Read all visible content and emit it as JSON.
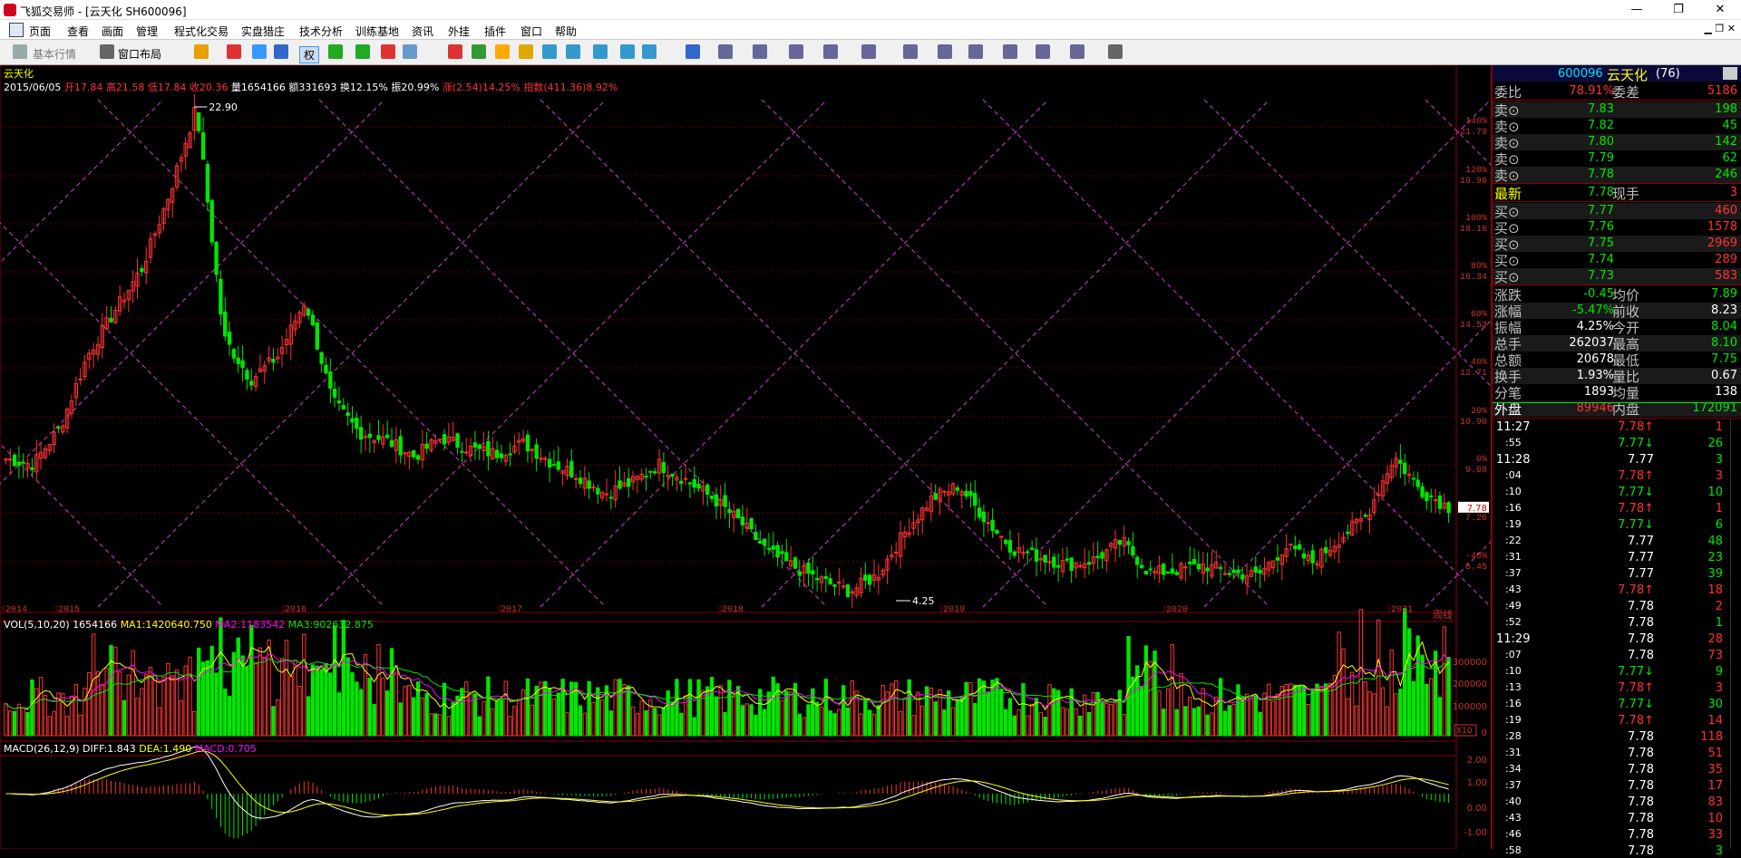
{
  "window": {
    "title": "飞狐交易师 - [云天化 SH600096]",
    "min": "—",
    "max": "❐",
    "close": "✕"
  },
  "menu": {
    "items": [
      "页面",
      "查看",
      "画面",
      "管理",
      "程式化交易",
      "实盘猎庄",
      "技术分析",
      "训练基地",
      "资讯",
      "外挂",
      "插件",
      "窗口",
      "帮助"
    ],
    "ctrl": "▁ ❐ ✕"
  },
  "toolbar": {
    "basic": "基本行情",
    "layout": "窗口布局",
    "quan": "权"
  },
  "colors": {
    "up": "#ff3232",
    "down": "#00e600",
    "neutral": "#ffffff",
    "accent": "#ffff00",
    "grid": "#8b0000",
    "gann": "#cc44cc",
    "ma2": "#ff00ff",
    "scale": "#cc3333"
  },
  "main_chart": {
    "name": "云天化",
    "info": {
      "date": "2015/06/05",
      "open": "开17.84",
      "high": "高21.58",
      "low": "低17.84",
      "close": "收20.36",
      "vol": "量1654166",
      "amt": "额331693",
      "turnover": "换12.15%",
      "amp": "振20.99%",
      "chg": "涨(2.54)14.25%",
      "idx": "指数(411.36)8.92%"
    },
    "high_mark": "22.90",
    "low_mark": "4.25",
    "period": "周线",
    "last_price_tag": "7.78",
    "years": [
      "2014",
      "2015",
      "2016",
      "2017",
      "2018",
      "2019",
      "2020",
      "2021"
    ],
    "pct_labels": [
      "140%",
      "120%",
      "100%",
      "80%",
      "60%",
      "40%",
      "20%",
      "0%",
      "-20%",
      "-40%"
    ],
    "price_labels": [
      "21.79",
      "19.96",
      "18.16",
      "16.34",
      "14.53",
      "12.71",
      "10.90",
      "9.08",
      "7.26",
      "5.45"
    ]
  },
  "vol_panel": {
    "title": "VOL(5,10,20)",
    "vol": "1654166",
    "ma1": "MA1:1420640.750",
    "ma2": "MA2:1183542",
    "ma3": "MA3:902632.875",
    "scale": [
      "300000",
      "200000",
      "100000",
      "0"
    ],
    "unit": "X10"
  },
  "macd_panel": {
    "title": "MACD(26,12,9)",
    "diff": "DIFF:1.843",
    "dea": "DEA:1.490",
    "macd": "MACD:0.705",
    "scale": [
      "2.00",
      "1.00",
      "0.00",
      "-1.00"
    ]
  },
  "chart_data": {
    "type": "candlestick",
    "title": "云天化",
    "xlabel": "",
    "ylabel": "",
    "period": "周线",
    "ylim": [
      4.25,
      22.9
    ],
    "x": [
      "2014",
      "2015",
      "2016",
      "2017",
      "2018",
      "2019",
      "2020",
      "2021"
    ],
    "series": [
      {
        "values": [
          9.6,
          9.4,
          10.8,
          13.5,
          15.2,
          16.8,
          19.6,
          22.9,
          14.2,
          12.6,
          13.5,
          15.6,
          11.8,
          10.6,
          10.3,
          9.7,
          10.4,
          10.0,
          9.8,
          10.2,
          9.5,
          9.0,
          8.3,
          8.7,
          9.4,
          8.8,
          8.1,
          7.2,
          6.1,
          5.5,
          5.0,
          4.6,
          5.2,
          6.8,
          8.1,
          8.6,
          7.3,
          6.2,
          5.9,
          5.6,
          5.8,
          6.5,
          5.3,
          5.4,
          5.6,
          5.3,
          5.2,
          6.3,
          5.7,
          6.6,
          7.5,
          9.7,
          8.4,
          7.78
        ]
      }
    ]
  },
  "quote": {
    "code": "600096",
    "name": "云天化",
    "num": "(76)",
    "weibi_label": "委比",
    "weibi": "78.91%",
    "weicha_label": "委差",
    "weicha": "5186",
    "sell": [
      {
        "label": "卖⊙",
        "price": "7.83",
        "vol": "198"
      },
      {
        "label": "卖⊙",
        "price": "7.82",
        "vol": "45"
      },
      {
        "label": "卖⊙",
        "price": "7.80",
        "vol": "142"
      },
      {
        "label": "卖⊙",
        "price": "7.79",
        "vol": "62"
      },
      {
        "label": "卖⊙",
        "price": "7.78",
        "vol": "246"
      }
    ],
    "latest_label": "最新",
    "latest": "7.78",
    "xianshou_label": "现手",
    "xianshou": "3",
    "buy": [
      {
        "label": "买⊙",
        "price": "7.77",
        "vol": "460"
      },
      {
        "label": "买⊙",
        "price": "7.76",
        "vol": "1578"
      },
      {
        "label": "买⊙",
        "price": "7.75",
        "vol": "2969"
      },
      {
        "label": "买⊙",
        "price": "7.74",
        "vol": "289"
      },
      {
        "label": "买⊙",
        "price": "7.73",
        "vol": "583"
      }
    ],
    "stats": [
      {
        "l1": "涨跌",
        "v1": "-0.45",
        "l2": "均价",
        "v2": "7.89"
      },
      {
        "l1": "涨幅",
        "v1": "-5.47%",
        "l2": "前收",
        "v2": "8.23"
      },
      {
        "l1": "振幅",
        "v1": "4.25%",
        "l2": "今开",
        "v2": "8.04"
      },
      {
        "l1": "总手",
        "v1": "262037",
        "l2": "最高",
        "v2": "8.10"
      },
      {
        "l1": "总额",
        "v1": "20678",
        "l2": "最低",
        "v2": "7.75"
      },
      {
        "l1": "换手",
        "v1": "1.93%",
        "l2": "量比",
        "v2": "0.67"
      },
      {
        "l1": "分笔",
        "v1": "1893",
        "l2": "均量",
        "v2": "138"
      },
      {
        "l1": "外盘",
        "v1": "89946",
        "l2": "内盘",
        "v2": "172091"
      }
    ],
    "ticks": [
      {
        "t": "11:27",
        "p": "7.78",
        "a": "↑",
        "v": "1",
        "s": "S"
      },
      {
        "t": ":55",
        "p": "7.77",
        "a": "↓",
        "v": "26",
        "s": "B"
      },
      {
        "t": "11:28",
        "p": "7.77",
        "a": "",
        "v": "3",
        "s": "B"
      },
      {
        "t": ":04",
        "p": "7.78",
        "a": "↑",
        "v": "3",
        "s": "S"
      },
      {
        "t": ":10",
        "p": "7.77",
        "a": "↓",
        "v": "10",
        "s": "B"
      },
      {
        "t": ":16",
        "p": "7.78",
        "a": "↑",
        "v": "1",
        "s": "S"
      },
      {
        "t": ":19",
        "p": "7.77",
        "a": "↓",
        "v": "6",
        "s": "B"
      },
      {
        "t": ":22",
        "p": "7.77",
        "a": "",
        "v": "48",
        "s": "B"
      },
      {
        "t": ":31",
        "p": "7.77",
        "a": "",
        "v": "23",
        "s": "B"
      },
      {
        "t": ":37",
        "p": "7.77",
        "a": "",
        "v": "39",
        "s": "B"
      },
      {
        "t": ":43",
        "p": "7.78",
        "a": "↑",
        "v": "18",
        "s": "S"
      },
      {
        "t": ":49",
        "p": "7.78",
        "a": "",
        "v": "2",
        "s": "S"
      },
      {
        "t": ":52",
        "p": "7.78",
        "a": "",
        "v": "1",
        "s": "B"
      },
      {
        "t": "11:29",
        "p": "7.78",
        "a": "",
        "v": "28",
        "s": "S"
      },
      {
        "t": ":07",
        "p": "7.78",
        "a": "",
        "v": "73",
        "s": "S"
      },
      {
        "t": ":10",
        "p": "7.77",
        "a": "↓",
        "v": "9",
        "s": "B"
      },
      {
        "t": ":13",
        "p": "7.78",
        "a": "↑",
        "v": "3",
        "s": "S"
      },
      {
        "t": ":16",
        "p": "7.77",
        "a": "↓",
        "v": "30",
        "s": "B"
      },
      {
        "t": ":19",
        "p": "7.78",
        "a": "↑",
        "v": "14",
        "s": "S"
      },
      {
        "t": ":28",
        "p": "7.78",
        "a": "",
        "v": "118",
        "s": "S"
      },
      {
        "t": ":31",
        "p": "7.78",
        "a": "",
        "v": "51",
        "s": "S"
      },
      {
        "t": ":34",
        "p": "7.78",
        "a": "",
        "v": "35",
        "s": "S"
      },
      {
        "t": ":37",
        "p": "7.78",
        "a": "",
        "v": "17",
        "s": "S"
      },
      {
        "t": ":40",
        "p": "7.78",
        "a": "",
        "v": "83",
        "s": "S"
      },
      {
        "t": ":43",
        "p": "7.78",
        "a": "",
        "v": "10",
        "s": "S"
      },
      {
        "t": ":46",
        "p": "7.78",
        "a": "",
        "v": "33",
        "s": "S"
      },
      {
        "t": ":58",
        "p": "7.78",
        "a": "",
        "v": "3",
        "s": "B"
      }
    ]
  }
}
